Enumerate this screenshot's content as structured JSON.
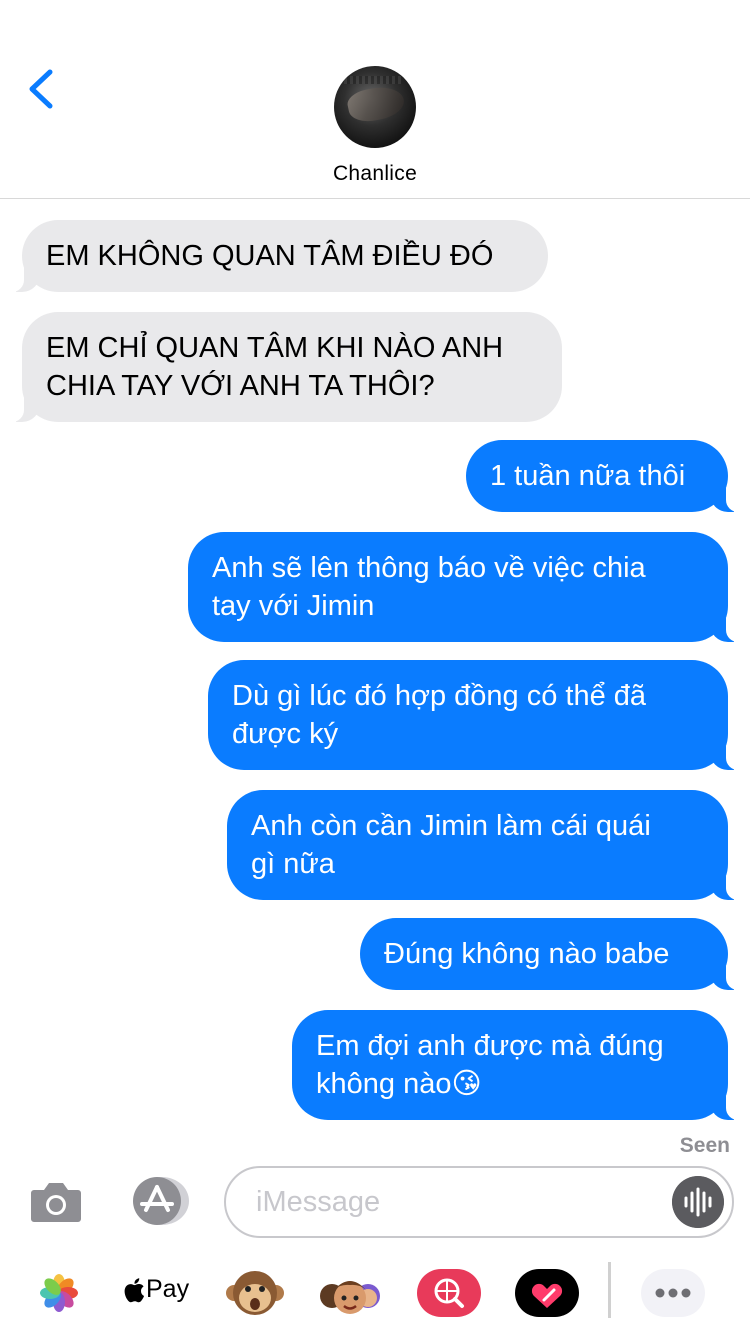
{
  "header": {
    "contact_name": "Chanlice"
  },
  "messages": [
    {
      "direction": "incoming",
      "lines": [
        "EM KHÔNG QUAN TÂM ĐIỀU ĐÓ"
      ]
    },
    {
      "direction": "incoming",
      "lines": [
        "EM CHỈ QUAN TÂM KHI NÀO ANH",
        "CHIA TAY VỚI ANH TA THÔI?"
      ]
    },
    {
      "direction": "outgoing",
      "lines": [
        "1 tuần nữa thôi"
      ]
    },
    {
      "direction": "outgoing",
      "lines": [
        "Anh sẽ lên thông báo về việc chia",
        "tay với Jimin"
      ]
    },
    {
      "direction": "outgoing",
      "lines": [
        "Dù gì lúc đó hợp đồng có thể đã",
        "được ký"
      ]
    },
    {
      "direction": "outgoing",
      "lines": [
        "Anh còn cần Jimin làm cái quái",
        "gì nữa"
      ]
    },
    {
      "direction": "outgoing",
      "lines": [
        "Đúng không nào babe"
      ]
    },
    {
      "direction": "outgoing",
      "lines": [
        "Em đợi anh được mà đúng",
        "không nào😘"
      ]
    }
  ],
  "status": {
    "seen": "Seen"
  },
  "composer": {
    "placeholder": "iMessage"
  },
  "app_strip": {
    "applepay_label": "Pay",
    "items": [
      "photos-icon",
      "apple-pay-icon",
      "animoji-monkey-icon",
      "memoji-icon",
      "web-search-icon",
      "digital-touch-icon",
      "more-icon"
    ]
  },
  "colors": {
    "outgoing_bubble": "#0a7cff",
    "incoming_bubble": "#e9e9eb",
    "accent": "#0a7cff",
    "battery": "#4cd964"
  }
}
